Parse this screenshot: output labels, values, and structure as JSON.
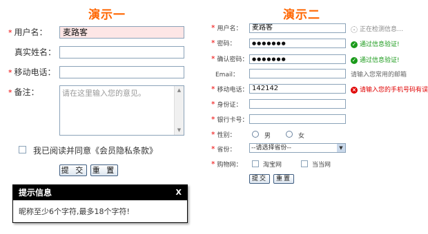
{
  "demo1": {
    "title": "演示一",
    "star": "*",
    "labels": {
      "username": "用户名：",
      "realname": "真实姓名：",
      "mobile": "移动电话：",
      "remark": "备注："
    },
    "username_value": "麦路客",
    "remark_placeholder": "请在这里输入您的意见。",
    "agree_label": "我已阅读并同意《会员隐私条款》",
    "submit_label": "提 交",
    "reset_label": "重 置",
    "tip": {
      "title": "提示信息",
      "close": "X",
      "message": "昵称至少6个字符,最多18个字符!"
    }
  },
  "demo2": {
    "title": "演示二",
    "star": "*",
    "labels": {
      "username": "用户名：",
      "password": "密码：",
      "confirm": "确认密码：",
      "email": "Email：",
      "mobile": "移动电话：",
      "idcard": "身份证：",
      "bankcard": "银行卡号：",
      "gender": "性别：",
      "province": "省份：",
      "shopping": "购物网："
    },
    "values": {
      "username": "麦路客",
      "password": "●●●●●●●",
      "confirm": "●●●●●●●",
      "mobile": "142142"
    },
    "messages": {
      "username": "正在检测信息…",
      "password": "通过信息验证!",
      "confirm": "通过信息验证!",
      "email": "请输入您常用的邮箱",
      "mobile": "请输入您的手机号码有误!"
    },
    "gender_options": {
      "male": "男",
      "female": "女"
    },
    "province_selected": "--请选择省份--",
    "shopping_options": {
      "taobao": "淘宝网",
      "dangdang": "当当网"
    },
    "submit_label": "提交",
    "reset_label": "重置"
  },
  "colors": {
    "accent": "#ff6600",
    "error": "#e00000",
    "success": "#1a9a1a",
    "input_error_bg": "#fde6e6"
  },
  "icons": {
    "spinner": "spinner-icon",
    "ok": "check-circle-icon",
    "error": "error-circle-icon",
    "dropdown": "chevron-down-icon"
  }
}
